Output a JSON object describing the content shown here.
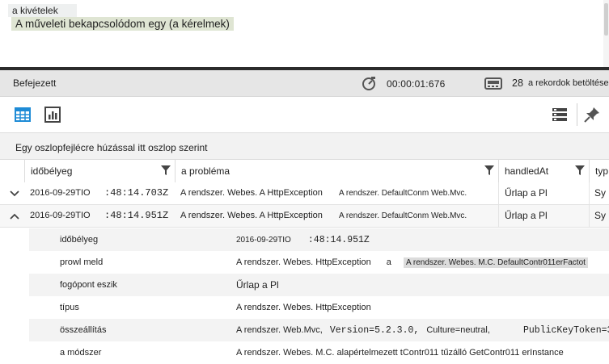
{
  "editor": {
    "line1": "a kivételek",
    "line2": "A műveleti bekapcsolódom egy (a kérelmek)"
  },
  "status": {
    "label": "Befejezett",
    "elapsed": "00:00:01:676",
    "record_count": "28",
    "records_label": "a rekordok betöltése"
  },
  "toolbar": {
    "icons": [
      "table-view-icon",
      "chart-view-icon",
      "columns-icon",
      "pin-icon"
    ]
  },
  "groupby": {
    "hint": "Egy oszlopfejlécre húzással itt oszlop szerint"
  },
  "grid": {
    "columns": [
      "időbélyeg",
      "a probléma",
      "handledAt",
      "typ"
    ],
    "rows": [
      {
        "date": "2016-09-29TIO",
        "time": ":48:14.703Z",
        "problem_a": "A rendszer. Webes. A HttpException",
        "problem_b": "A rendszer. DefaultConm Web.Mvc.",
        "handled": "Űrlap a Pl",
        "type": "Sy"
      },
      {
        "date": "2016-09-29TIO",
        "time": ":48:14.951Z",
        "problem_a": "A rendszer. Webes. A HttpException",
        "problem_b": "A rendszer. DefaultConm Web.Mvc.",
        "handled": "Űrlap a Pl",
        "type": "Sy"
      }
    ]
  },
  "details": {
    "timestamp_key": "időbélyeg",
    "timestamp_date": "2016-09-29TIO",
    "timestamp_time": ":48:14.951Z",
    "prowl_key": "prowl meld",
    "prowl_value": "A rendszer. Webes. HttpException",
    "prowl_a": "a",
    "prowl_highlight": "A rendszer. Webes. M.C. DefaultContr011erFactot",
    "handled_key": "fogópont eszik",
    "handled_value": "Űrlap a Pl",
    "type_key": "típus",
    "type_value": "A rendszer. Webes. HttpException",
    "assembly_key": "összeállítás",
    "assembly_value": "A rendszer. Web.Mvc,",
    "assembly_version": "Version=5.2.3.0,",
    "assembly_culture": "Culture=neutral,",
    "assembly_token": "PublicKeyToken=3",
    "method_key": "a módszer",
    "method_value": "A rendszer. Webes. M.C. alapértelmezett tContr011 tűzálló GetContr011 erInstance"
  }
}
